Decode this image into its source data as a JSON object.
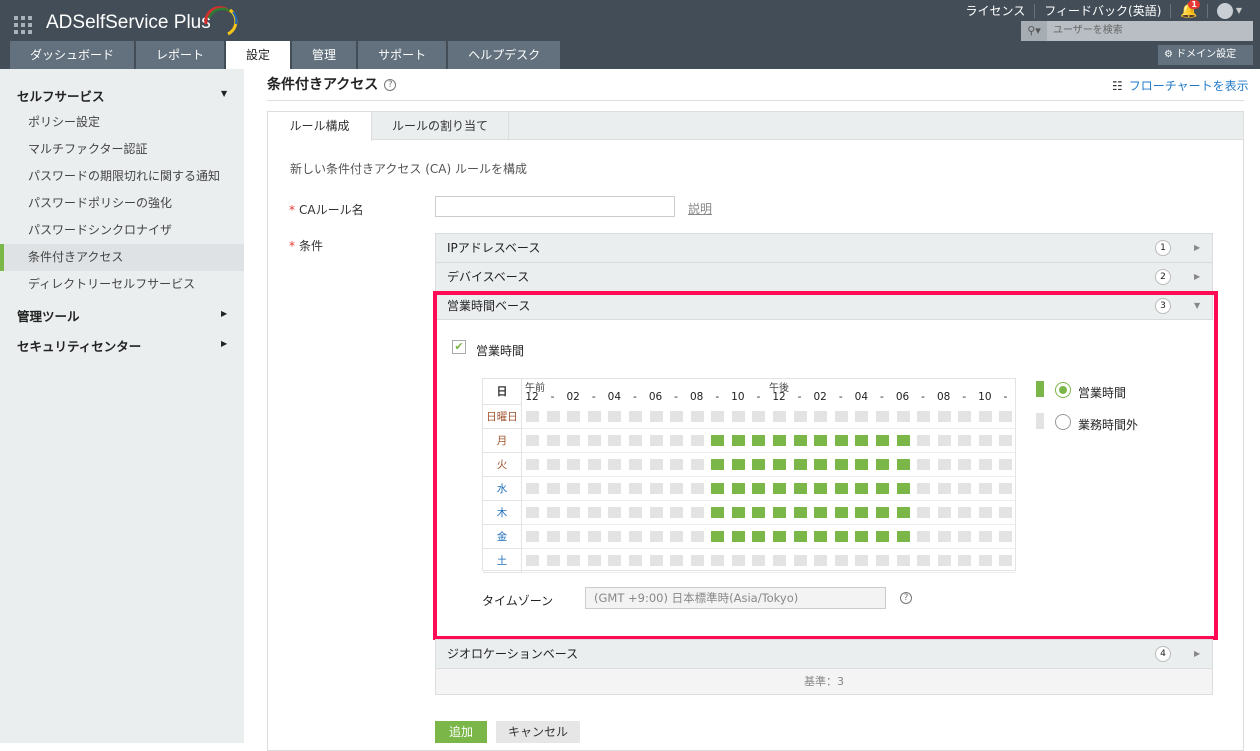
{
  "app": {
    "title": "ADSelfService Plus"
  },
  "nav_tabs": [
    "ダッシュボード",
    "レポート",
    "設定",
    "管理",
    "サポート",
    "ヘルプデスク"
  ],
  "active_tab": 2,
  "top_links": {
    "license": "ライセンス",
    "feedback": "フィードバック(英語)",
    "notifications": "1"
  },
  "search": {
    "placeholder": "ユーザーを検索"
  },
  "domain_settings": "ドメイン設定",
  "sidebar": {
    "section1": "セルフサービス",
    "items": [
      "ポリシー設定",
      "マルチファクター認証",
      "パスワードの期限切れに関する通知",
      "パスワードポリシーの強化",
      "パスワードシンクロナイザ",
      "条件付きアクセス",
      "ディレクトリーセルフサービス"
    ],
    "active_item": 5,
    "section2": "管理ツール",
    "section3": "セキュリティセンター"
  },
  "page": {
    "title": "条件付きアクセス",
    "help": "?",
    "flowchart_link": "フローチャートを表示"
  },
  "panel_tabs": [
    "ルール構成",
    "ルールの割り当て"
  ],
  "form": {
    "subtitle": "新しい条件付きアクセス (CA) ルールを構成",
    "required_mark": "*",
    "rule_name_label": "CAルール名",
    "rule_name_value": "",
    "description_link": "説明",
    "conditions_label": "条件"
  },
  "conditions": [
    {
      "label": "IPアドレスベース",
      "num": "1",
      "expanded": false
    },
    {
      "label": "デバイスベース",
      "num": "2",
      "expanded": false
    },
    {
      "label": "営業時間ベース",
      "num": "3",
      "expanded": true
    },
    {
      "label": "ジオロケーションベース",
      "num": "4",
      "expanded": false
    }
  ],
  "business_hours": {
    "checkbox_label": "営業時間",
    "checked": true,
    "day_header": "日",
    "am_label": "午前",
    "pm_label": "午後",
    "hour_labels": [
      "12",
      "-",
      "02",
      "-",
      "04",
      "-",
      "06",
      "-",
      "08",
      "-",
      "10",
      "-",
      "12",
      "-",
      "02",
      "-",
      "04",
      "-",
      "06",
      "-",
      "08",
      "-",
      "10",
      "-"
    ],
    "days": [
      {
        "label": "日曜日",
        "active_hours": []
      },
      {
        "label": "月",
        "active_hours": [
          9,
          10,
          11,
          12,
          13,
          14,
          15,
          16,
          17,
          18
        ]
      },
      {
        "label": "火",
        "active_hours": [
          9,
          10,
          11,
          12,
          13,
          14,
          15,
          16,
          17,
          18
        ]
      },
      {
        "label": "水",
        "active_hours": [
          9,
          10,
          11,
          12,
          13,
          14,
          15,
          16,
          17,
          18
        ]
      },
      {
        "label": "木",
        "active_hours": [
          9,
          10,
          11,
          12,
          13,
          14,
          15,
          16,
          17,
          18
        ]
      },
      {
        "label": "金",
        "active_hours": [
          9,
          10,
          11,
          12,
          13,
          14,
          15,
          16,
          17,
          18
        ]
      },
      {
        "label": "土",
        "active_hours": []
      }
    ],
    "legend_business": "営業時間",
    "legend_non_business": "業務時間外",
    "legend_selected": "business",
    "timezone_label": "タイムゾーン",
    "timezone_value": "(GMT +9:00) 日本標準時(Asia/Tokyo)"
  },
  "criteria_text": "基準：3",
  "buttons": {
    "add": "追加",
    "cancel": "キャンセル"
  },
  "colors": {
    "accent_green": "#7ab648",
    "highlight": "#ff0a55",
    "topbar": "#424d57",
    "link": "#1f7ac9"
  }
}
